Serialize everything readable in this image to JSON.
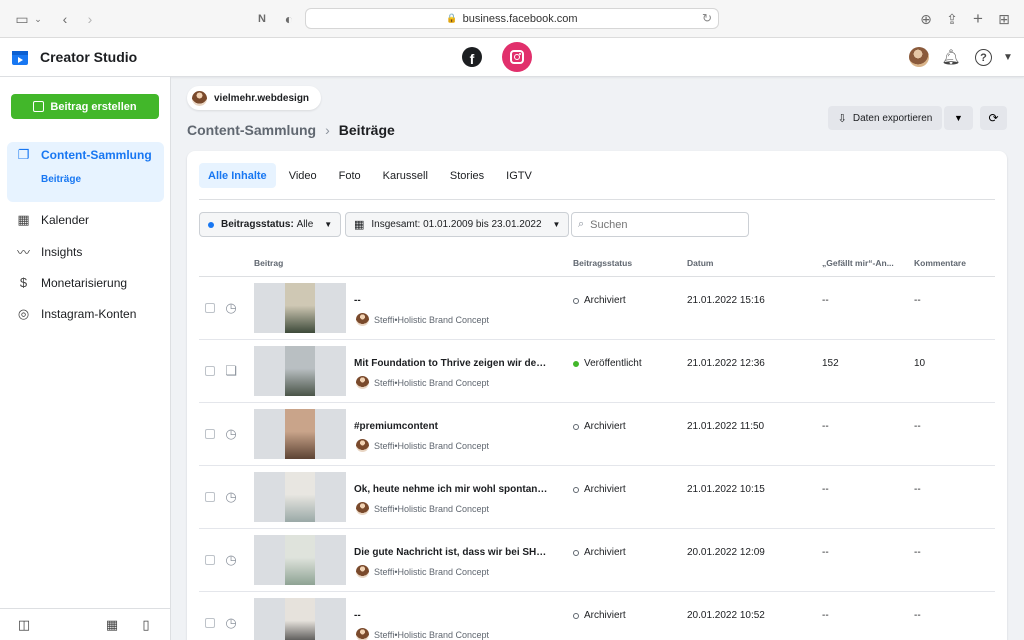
{
  "browser": {
    "url": "business.facebook.com"
  },
  "app": {
    "title": "Creator Studio",
    "facebook_glyph": "f"
  },
  "sidebar": {
    "create_button": "Beitrag erstellen",
    "items": [
      {
        "label": "Content-Sammlung",
        "icon": "content-library-icon",
        "active": true,
        "sub": "Beiträge"
      },
      {
        "label": "Kalender",
        "icon": "calendar-icon"
      },
      {
        "label": "Insights",
        "icon": "insights-icon"
      },
      {
        "label": "Monetarisierung",
        "icon": "dollar-icon"
      },
      {
        "label": "Instagram-Konten",
        "icon": "accounts-icon"
      }
    ]
  },
  "account": {
    "name": "vielmehr.webdesign"
  },
  "breadcrumb": {
    "parent": "Content-Sammlung",
    "current": "Beiträge"
  },
  "toolbar": {
    "export_label": "Daten exportieren"
  },
  "tabs": [
    "Alle Inhalte",
    "Video",
    "Foto",
    "Karussell",
    "Stories",
    "IGTV"
  ],
  "filters": {
    "status_label": "Beitragsstatus:",
    "status_value": "Alle",
    "date_range": "Insgesamt: 01.01.2009 bis 23.01.2022",
    "search_placeholder": "Suchen"
  },
  "table": {
    "headers": {
      "post": "Beitrag",
      "status": "Beitragsstatus",
      "date": "Datum",
      "likes": "„Gefällt mir“-An...",
      "comments": "Kommentare"
    },
    "rows": [
      {
        "caption": "--",
        "author": "Steffi•Holistic Brand Concept",
        "status": "Archiviert",
        "published": false,
        "date": "21.01.2022 15:16",
        "likes": "--",
        "comments": "--",
        "type": "history-icon",
        "thumb": [
          "#cfc8b4",
          "#3d4a3a"
        ]
      },
      {
        "caption": "Mit Foundation to Thrive zeigen wir der W...",
        "author": "Steffi•Holistic Brand Concept",
        "status": "Veröffentlicht",
        "published": true,
        "date": "21.01.2022 12:36",
        "likes": "152",
        "comments": "10",
        "type": "carousel-icon",
        "thumb": [
          "#b9bfc2",
          "#4a5448"
        ]
      },
      {
        "caption": "#premiumcontent",
        "author": "Steffi•Holistic Brand Concept",
        "status": "Archiviert",
        "published": false,
        "date": "21.01.2022 11:50",
        "likes": "--",
        "comments": "--",
        "type": "history-icon",
        "thumb": [
          "#c9a48a",
          "#5c4334"
        ]
      },
      {
        "caption": "Ok, heute nehme ich mir wohl spontan frei...",
        "author": "Steffi•Holistic Brand Concept",
        "status": "Archiviert",
        "published": false,
        "date": "21.01.2022 10:15",
        "likes": "--",
        "comments": "--",
        "type": "history-icon",
        "thumb": [
          "#e8e6e1",
          "#9aa9a7"
        ]
      },
      {
        "caption": "Die gute Nachricht ist, dass wir bei SHOW ...",
        "author": "Steffi•Holistic Brand Concept",
        "status": "Archiviert",
        "published": false,
        "date": "20.01.2022 12:09",
        "likes": "--",
        "comments": "--",
        "type": "history-icon",
        "thumb": [
          "#dfe3dc",
          "#8ea394"
        ]
      },
      {
        "caption": "--",
        "author": "Steffi•Holistic Brand Concept",
        "status": "Archiviert",
        "published": false,
        "date": "20.01.2022 10:52",
        "likes": "--",
        "comments": "--",
        "type": "history-icon",
        "thumb": [
          "#e6e2dc",
          "#2a2a2a"
        ]
      }
    ]
  },
  "colors": {
    "accent": "#1877f2",
    "create": "#42b72a",
    "instagram": "#e1306c"
  }
}
